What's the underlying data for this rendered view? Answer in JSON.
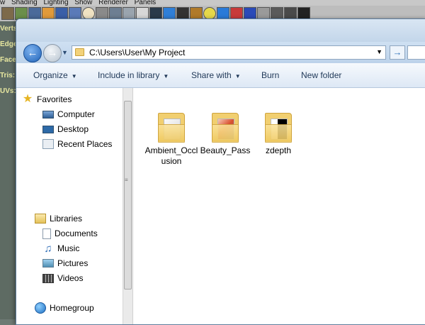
{
  "background_app": {
    "menu": [
      "w",
      "Shading",
      "Lighting",
      "Show",
      "Renderer",
      "Panels"
    ],
    "hud_labels": [
      "Verts:",
      "Edges:",
      "Faces:",
      "Tris:",
      "UVs:"
    ]
  },
  "explorer": {
    "address": {
      "path": "C:\\Users\\User\\My Project"
    },
    "toolbar": {
      "organize": "Organize",
      "include_in_library": "Include in library",
      "share_with": "Share with",
      "burn": "Burn",
      "new_folder": "New folder"
    },
    "nav": {
      "favorites": {
        "label": "Favorites",
        "items": [
          {
            "label": "Computer",
            "icon": "computer-icon"
          },
          {
            "label": "Desktop",
            "icon": "desktop-icon"
          },
          {
            "label": "Recent Places",
            "icon": "recent-places-icon"
          }
        ]
      },
      "libraries": {
        "label": "Libraries",
        "items": [
          {
            "label": "Documents",
            "icon": "documents-icon"
          },
          {
            "label": "Music",
            "icon": "music-icon"
          },
          {
            "label": "Pictures",
            "icon": "pictures-icon"
          },
          {
            "label": "Videos",
            "icon": "videos-icon"
          }
        ]
      },
      "homegroup": {
        "label": "Homegroup"
      }
    },
    "folders": [
      {
        "name": "Ambient_Occlusion"
      },
      {
        "name": "Beauty_Pass"
      },
      {
        "name": "zdepth"
      }
    ]
  }
}
